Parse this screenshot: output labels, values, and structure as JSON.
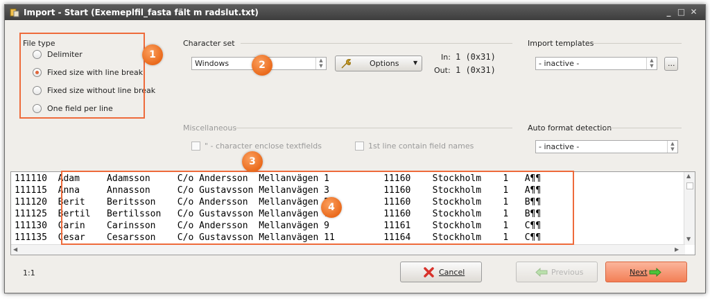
{
  "window": {
    "title": "Import - Start  (Exemeplfil_fasta fält m radslut.txt)"
  },
  "file_type": {
    "label": "File type",
    "options": [
      "Delimiter",
      "Fixed size with line break",
      "Fixed size without line break",
      "One field per line"
    ],
    "selected": "Fixed size with line break"
  },
  "charset": {
    "label": "Character set",
    "value": "Windows",
    "options_button": "Options",
    "in_label": "In:",
    "in_value": "1 (0x31)",
    "out_label": "Out:",
    "out_value": "1 (0x31)"
  },
  "templates": {
    "label": "Import templates",
    "value": "- inactive -",
    "browse_button": "..."
  },
  "misc": {
    "label": "Miscellaneous",
    "enclose_label": "\" - character enclose textfields",
    "first_line_label": "1st line contain field names"
  },
  "auto_format": {
    "label": "Auto format detection",
    "value": "- inactive -"
  },
  "preview": {
    "rows": [
      "111110  Adam     Adamsson     C/o Andersson  Mellanvägen 1          11160    Stockholm    1   A¶¶",
      "111115  Anna     Annasson     C/o Gustavsson Mellanvägen 3          11160    Stockholm    1   A¶¶",
      "111120  Berit    Beritsson    C/o Andersson  Mellanvägen 5          11160    Stockholm    1   B¶¶",
      "111125  Bertil   Bertilsson   C/o Gustavsson Mellanvägen 7          11160    Stockholm    1   B¶¶",
      "111130  Carin    Carinsson    C/o Andersson  Mellanvägen 9          11161    Stockholm    1   C¶¶",
      "111135  Cesar    Cesarsson    C/o Gustavsson Mellanvägen 11         11164    Stockholm    1   C¶¶"
    ]
  },
  "badges": [
    "1",
    "2",
    "3",
    "4"
  ],
  "status": {
    "position": "1:1"
  },
  "footer": {
    "cancel": "Cancel",
    "previous": "Previous",
    "next": "Next"
  },
  "colors": {
    "accent": "#ee6a3a",
    "titlebar": "#4a4a4a",
    "dialog_bg": "#f0eeea"
  }
}
